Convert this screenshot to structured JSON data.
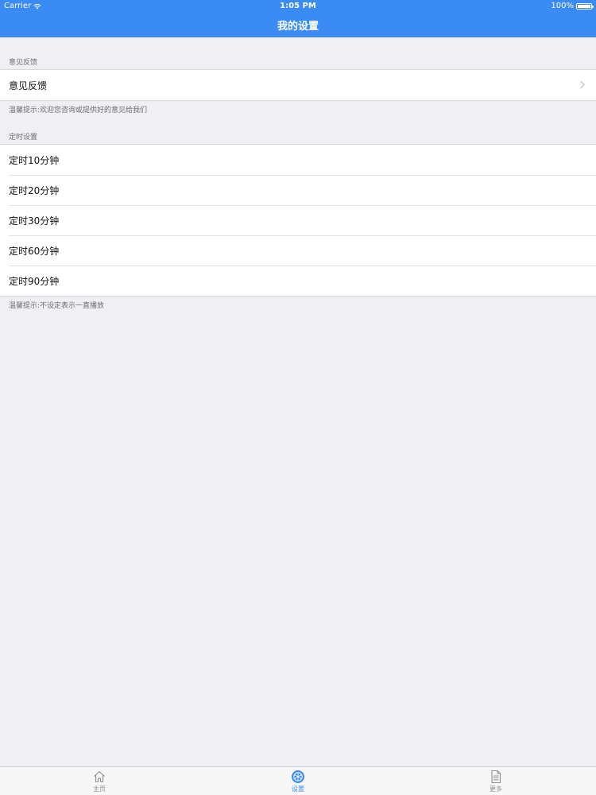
{
  "status_bar": {
    "carrier": "Carrier",
    "time": "1:05 PM",
    "battery": "100%"
  },
  "nav": {
    "title": "我的设置"
  },
  "feedback_section": {
    "header": "意见反馈",
    "items": [
      {
        "label": "意见反馈"
      }
    ],
    "footer": "温馨提示:欢迎您咨询或提供好的意见给我们"
  },
  "timer_section": {
    "header": "定时设置",
    "items": [
      {
        "label": "定时10分钟"
      },
      {
        "label": "定时20分钟"
      },
      {
        "label": "定时30分钟"
      },
      {
        "label": "定时60分钟"
      },
      {
        "label": "定时90分钟"
      }
    ],
    "footer": "温馨提示:不设定表示一直播放"
  },
  "tabbar": {
    "tabs": [
      {
        "label": "主页",
        "icon": "home-icon",
        "active": false
      },
      {
        "label": "设置",
        "icon": "settings-icon",
        "active": true
      },
      {
        "label": "更多",
        "icon": "document-icon",
        "active": false
      }
    ]
  },
  "colors": {
    "accent": "#3b8bf5",
    "background": "#efeff4",
    "inactive_tab": "#8e8e93"
  }
}
